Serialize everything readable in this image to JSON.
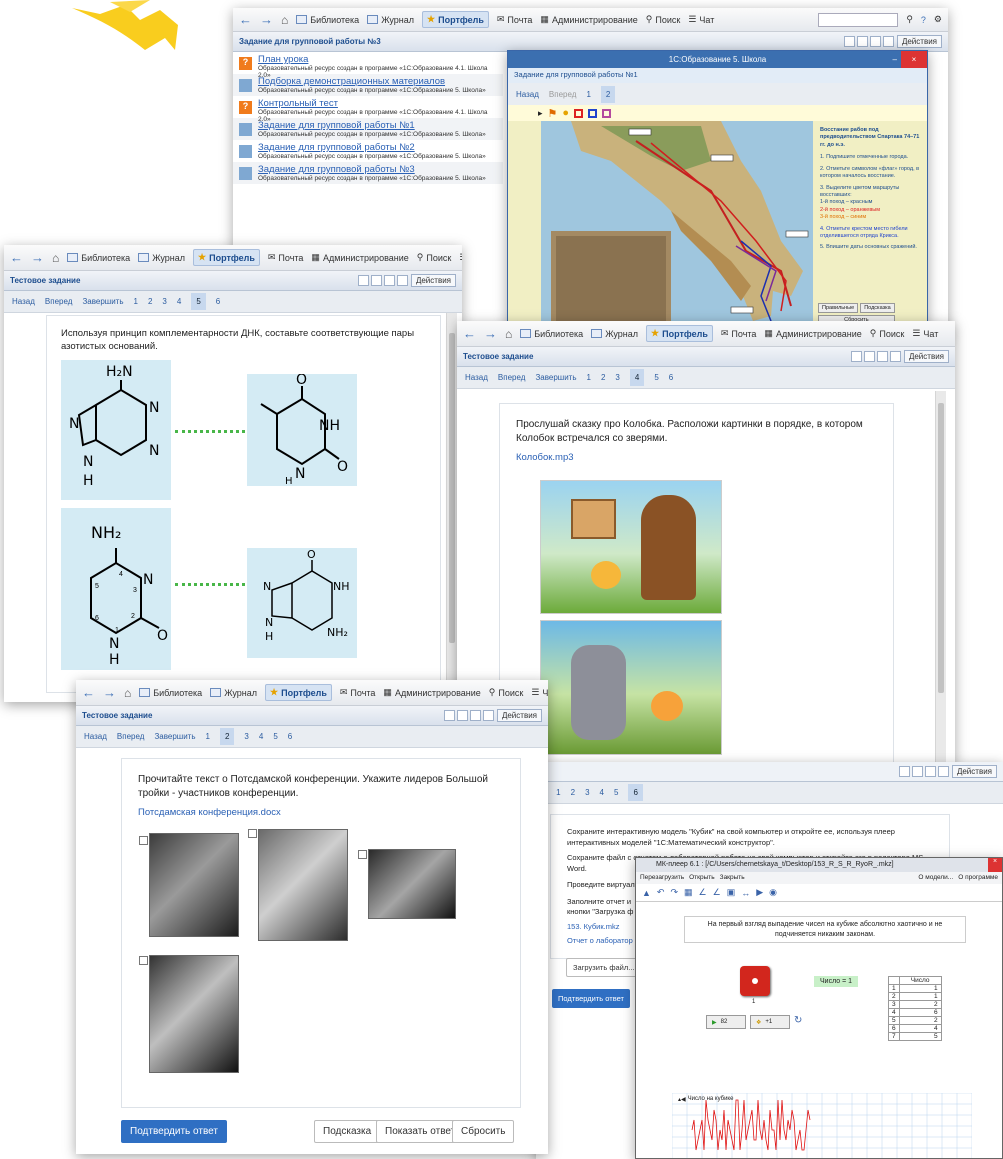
{
  "nav": {
    "library": "Библиотека",
    "journal": "Журнал",
    "portfolio": "Портфель",
    "mail": "Почта",
    "admin": "Администрирование",
    "search": "Поиск",
    "chat": "Чат"
  },
  "tests": {
    "tasks_label": "Тестовое задание",
    "actions": "Действия",
    "back": "Назад",
    "forward": "Вперед",
    "finish": "Завершить"
  },
  "w1": {
    "title": "Задание для групповой работы №3",
    "list": [
      {
        "title": "План урока",
        "sub": "Образовательный ресурс создан в программе «1С:Образование 4.1. Школа 2.0»"
      },
      {
        "title": "Подборка демонстрационных материалов",
        "sub": "Образовательный ресурс создан в программе «1С:Образование 5. Школа»"
      },
      {
        "title": "Контрольный тест",
        "sub": "Образовательный ресурс создан в программе «1С:Образование 4.1. Школа 2.0»"
      },
      {
        "title": "Задание для групповой работы №1",
        "sub": "Образовательный ресурс создан в программе «1С:Образование 5. Школа»"
      },
      {
        "title": "Задание для групповой работы №2",
        "sub": "Образовательный ресурс создан в программе «1С:Образование 5. Школа»"
      },
      {
        "title": "Задание для групповой работы №3",
        "sub": "Образовательный ресурс создан в программе «1С:Образование 5. Школа»"
      }
    ],
    "viewer": {
      "title": "1С:Образование 5. Школа",
      "subtitle": "Задание для групповой работы №1",
      "back": "Назад",
      "forward": "Вперед",
      "p1": "1",
      "p2": "2",
      "map_title": "Восстание рабов под предводительством Спартака 74–71 гг. до н.э.",
      "steps": [
        "1. Подпишите отмеченные города.",
        "2. Отметьте символом «флаг» город, в котором началось восстание.",
        "3. Выделите цветом маршруты восставших:",
        "1-й поход – красным",
        "2-й поход – оранжевым",
        "3-й поход – синим",
        "4. Отметьте крестом место гибели отделившегося отряда Крикса.",
        "5. Впишите даты основных сражений."
      ],
      "btn_rules": "Правильные",
      "btn_hint": "Подсказка",
      "btn_reset": "Сбросить"
    }
  },
  "w2": {
    "task": "Используя принцип комплементарности ДНК, составьте соответствующие пары азотистых оснований.",
    "pages": [
      "1",
      "2",
      "3",
      "4",
      "5",
      "6"
    ],
    "current": "5",
    "chem": {
      "h2n": "H₂N",
      "n": "N",
      "h": "H",
      "o": "O",
      "nh": "NH",
      "nh2": "NH₂",
      "c4": "4",
      "c5": "5",
      "c6": "6",
      "c3": "3",
      "c2": "2",
      "c1": "1"
    }
  },
  "w3": {
    "task": "Прослушай сказку про Колобка. Расположи картинки в порядке, в котором Колобок встречался со зверями.",
    "file": "Колобок.mp3",
    "pages": [
      "1",
      "2",
      "3",
      "4",
      "5",
      "6"
    ],
    "current": "4"
  },
  "w4": {
    "task": "Прочитайте текст о Потсдамской конференции. Укажите лидеров Большой тройки - участников конференции.",
    "file": "Потсдамская конференция.docx",
    "pages": [
      "1",
      "2",
      "3",
      "4",
      "5",
      "6"
    ],
    "current": "2",
    "submit": "Подтвердить ответ",
    "hint": "Подсказка",
    "show": "Показать ответ",
    "reset": "Сбросить"
  },
  "w5": {
    "actions": "Действия",
    "pages": [
      "1",
      "2",
      "3",
      "4",
      "5",
      "6"
    ],
    "current": "6",
    "p1": "Сохраните интерактивную модель \"Кубик\" на свой компьютер и откройте ее, используя плеер интерактивных моделей \"1С:Математический конструктор\".",
    "p2": "Сохраните файл с отчетом о лабораторной работе на свой компьютер и откройте его в редакторе MS Word.",
    "p3": "Проведите виртуальные эксперименты на листа №№1-4 модели. Сделайте выводы.",
    "p4": "Заполните отчет и",
    "p4b": "кнопки \"Загрузка ф",
    "link1": "153. Кубик.mkz",
    "link2": "Отчет о лаборатор",
    "upload": "Загрузить файл...",
    "submit": "Подтвердить ответ",
    "player": {
      "title": "МК-плеер 6.1 : [/C/Users/chernetskaya_t/Desktop/153_R_S_R_RyoR_.mkz]",
      "m1": "Перезагрузить",
      "m2": "Открыть",
      "m3": "Закрыть",
      "mr1": "О модели...",
      "mr2": "О программе",
      "note": "На первый взгляд выпадение чисел на кубике абсолютно хаотично и не подчиняется никаким законам.",
      "die_label": "1",
      "counter": "Число = 1",
      "col": "Число",
      "rows": [
        [
          "1",
          "1"
        ],
        [
          "2",
          "1"
        ],
        [
          "3",
          "2"
        ],
        [
          "4",
          "6"
        ],
        [
          "5",
          "2"
        ],
        [
          "6",
          "4"
        ],
        [
          "7",
          "5"
        ]
      ],
      "run_val": "82",
      "step_val": "+1",
      "chart_label": "Число на кубике"
    }
  }
}
